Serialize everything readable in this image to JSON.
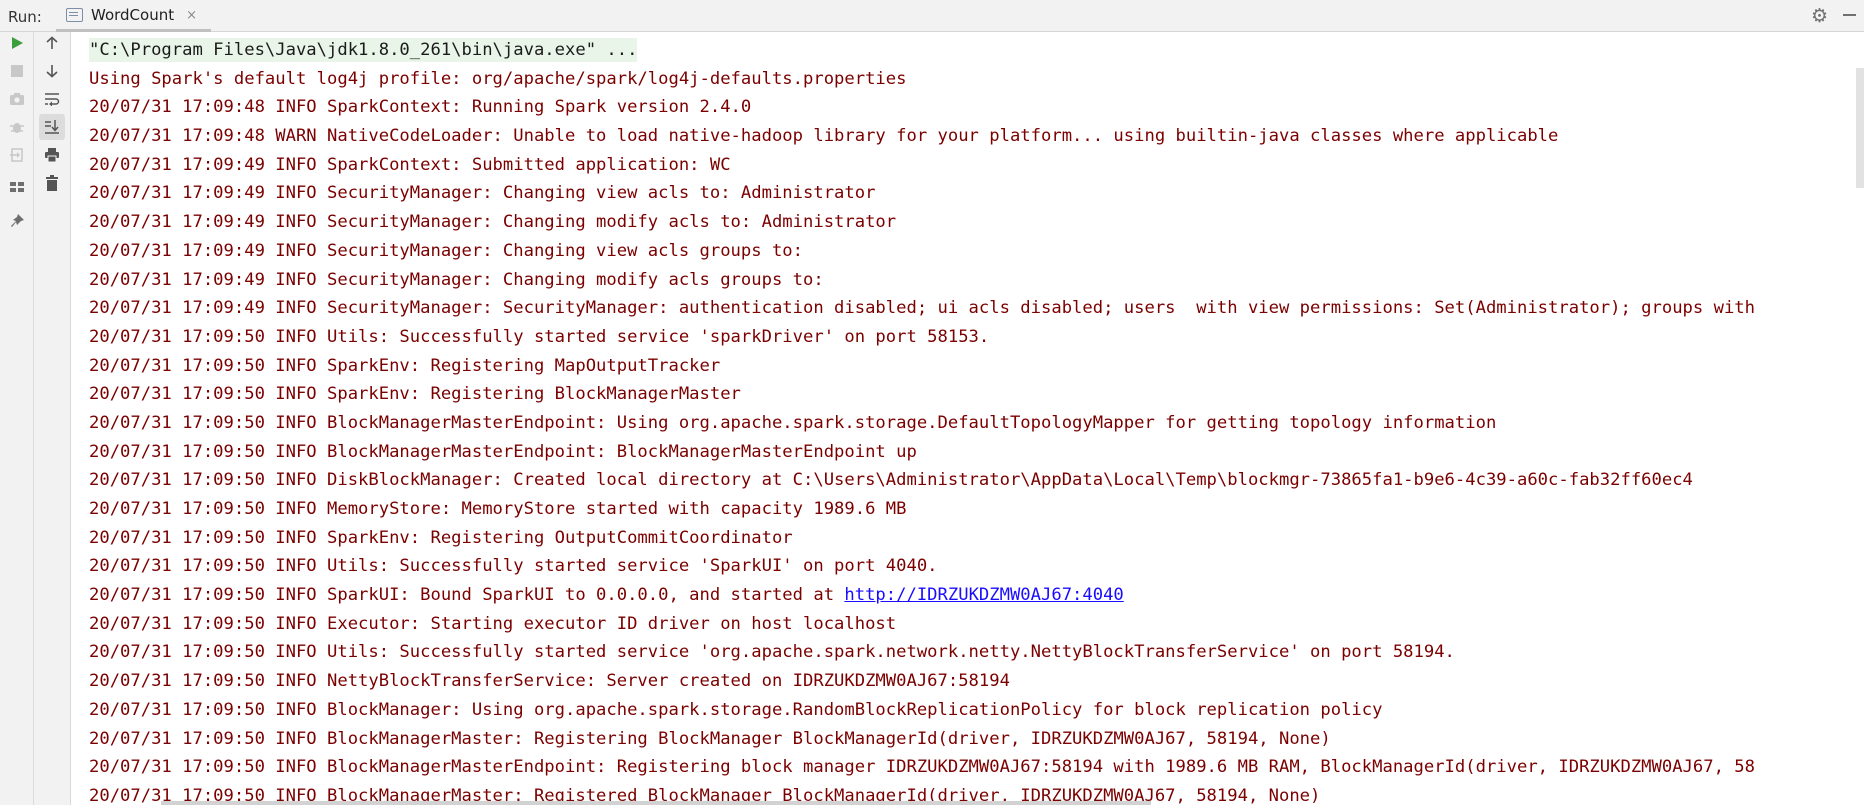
{
  "header": {
    "run_label": "Run:",
    "tab_label": "WordCount",
    "tab_close": "×"
  },
  "toolbar": {
    "left": [
      "run-icon",
      "stop-icon",
      "camera-icon",
      "debug-disabled-icon",
      "import-icon",
      "layout-icon",
      "pin-icon"
    ],
    "right": [
      "arrow-up-icon",
      "arrow-down-icon",
      "soft-wrap-icon",
      "scroll-to-end-icon",
      "print-icon",
      "trash-icon"
    ]
  },
  "console": {
    "command": "\"C:\\Program Files\\Java\\jdk1.8.0_261\\bin\\java.exe\" ...",
    "lines": [
      "Using Spark's default log4j profile: org/apache/spark/log4j-defaults.properties",
      "20/07/31 17:09:48 INFO SparkContext: Running Spark version 2.4.0",
      "20/07/31 17:09:48 WARN NativeCodeLoader: Unable to load native-hadoop library for your platform... using builtin-java classes where applicable",
      "20/07/31 17:09:49 INFO SparkContext: Submitted application: WC",
      "20/07/31 17:09:49 INFO SecurityManager: Changing view acls to: Administrator",
      "20/07/31 17:09:49 INFO SecurityManager: Changing modify acls to: Administrator",
      "20/07/31 17:09:49 INFO SecurityManager: Changing view acls groups to:",
      "20/07/31 17:09:49 INFO SecurityManager: Changing modify acls groups to:",
      "20/07/31 17:09:49 INFO SecurityManager: SecurityManager: authentication disabled; ui acls disabled; users  with view permissions: Set(Administrator); groups with",
      "20/07/31 17:09:50 INFO Utils: Successfully started service 'sparkDriver' on port 58153.",
      "20/07/31 17:09:50 INFO SparkEnv: Registering MapOutputTracker",
      "20/07/31 17:09:50 INFO SparkEnv: Registering BlockManagerMaster",
      "20/07/31 17:09:50 INFO BlockManagerMasterEndpoint: Using org.apache.spark.storage.DefaultTopologyMapper for getting topology information",
      "20/07/31 17:09:50 INFO BlockManagerMasterEndpoint: BlockManagerMasterEndpoint up",
      "20/07/31 17:09:50 INFO DiskBlockManager: Created local directory at C:\\Users\\Administrator\\AppData\\Local\\Temp\\blockmgr-73865fa1-b9e6-4c39-a60c-fab32ff60ec4",
      "20/07/31 17:09:50 INFO MemoryStore: MemoryStore started with capacity 1989.6 MB",
      "20/07/31 17:09:50 INFO SparkEnv: Registering OutputCommitCoordinator",
      "20/07/31 17:09:50 INFO Utils: Successfully started service 'SparkUI' on port 4040."
    ],
    "sparkui_prefix": "20/07/31 17:09:50 INFO SparkUI: Bound SparkUI to 0.0.0.0, and started at ",
    "sparkui_link": "http://IDRZUKDZMW0AJ67:4040",
    "lines_after": [
      "20/07/31 17:09:50 INFO Executor: Starting executor ID driver on host localhost",
      "20/07/31 17:09:50 INFO Utils: Successfully started service 'org.apache.spark.network.netty.NettyBlockTransferService' on port 58194.",
      "20/07/31 17:09:50 INFO NettyBlockTransferService: Server created on IDRZUKDZMW0AJ67:58194",
      "20/07/31 17:09:50 INFO BlockManager: Using org.apache.spark.storage.RandomBlockReplicationPolicy for block replication policy",
      "20/07/31 17:09:50 INFO BlockManagerMaster: Registering BlockManager BlockManagerId(driver, IDRZUKDZMW0AJ67, 58194, None)",
      "20/07/31 17:09:50 INFO BlockManagerMasterEndpoint: Registering block manager IDRZUKDZMW0AJ67:58194 with 1989.6 MB RAM, BlockManagerId(driver, IDRZUKDZMW0AJ67, 58",
      "20/07/31 17:09:50 INFO BlockManagerMaster: Registered BlockManager BlockManagerId(driver, IDRZUKDZMW0AJ67, 58194, None)"
    ]
  },
  "colors": {
    "log_text": "#7b0000",
    "link": "#1a0dff",
    "run_green": "#3c9e3c",
    "panel_bg": "#f2f2f2"
  }
}
